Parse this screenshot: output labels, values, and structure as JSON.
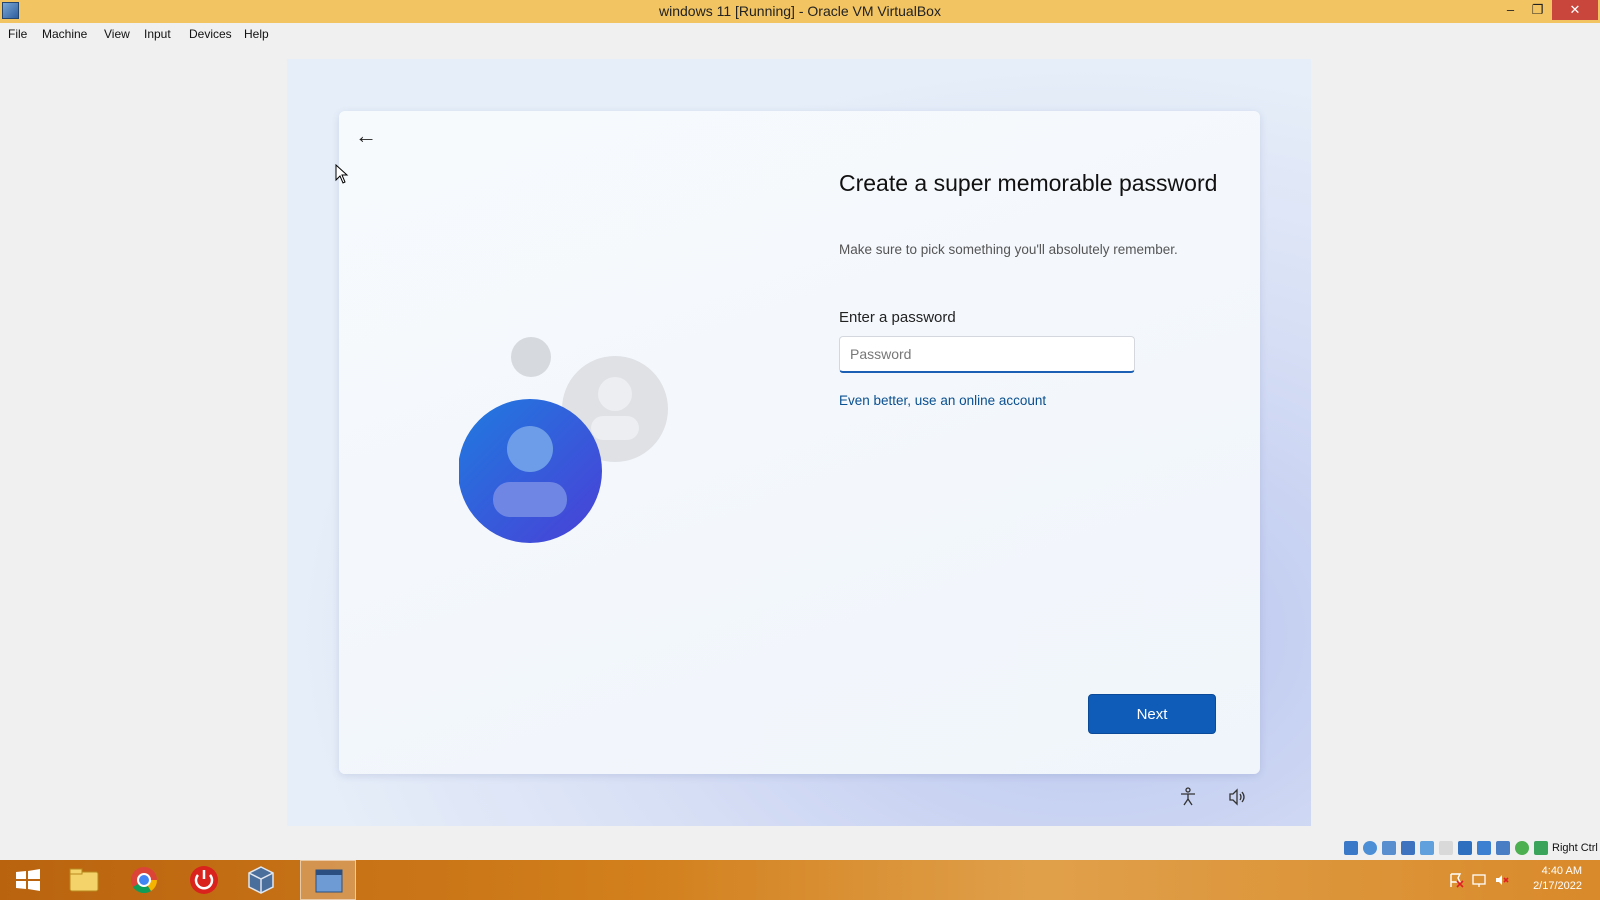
{
  "window": {
    "title": "windows 11 [Running] - Oracle VM VirtualBox",
    "minimize": "‒",
    "maximize": "❐",
    "close": "✕"
  },
  "menu": [
    "File",
    "Machine",
    "View",
    "Input",
    "Devices",
    "Help"
  ],
  "setup": {
    "back_arrow": "←",
    "heading": "Create a super memorable password",
    "subtitle": "Make sure to pick something you'll absolutely remember.",
    "password_label": "Enter a password",
    "password_placeholder": "Password",
    "password_value": "",
    "online_link": "Even better, use an online account",
    "next_button": "Next",
    "accent_color": "#0f5cb8"
  },
  "statusbar": {
    "host_key": "Right Ctrl",
    "indicators": [
      "hard-disk-icon",
      "optical-drive-icon",
      "audio-icon",
      "network-icon",
      "usb-icon",
      "shared-folders-icon",
      "display-icon",
      "video-capture-icon",
      "vt-x-icon",
      "guest-additions-icon",
      "mouse-integration-icon"
    ]
  },
  "taskbar": {
    "items": [
      "start-button",
      "file-explorer",
      "chrome",
      "power-app",
      "virtualbox-manager",
      "virtualbox-vm"
    ],
    "time": "4:40 AM",
    "date": "2/17/2022"
  }
}
